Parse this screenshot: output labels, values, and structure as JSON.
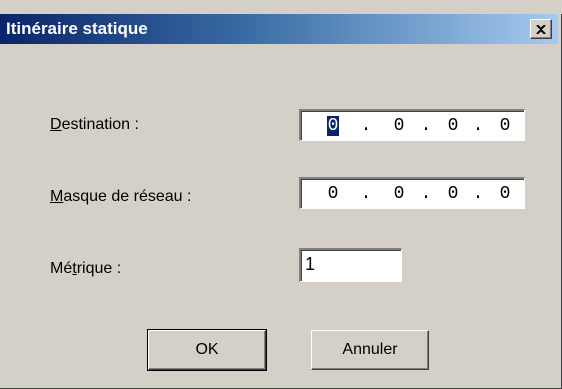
{
  "window": {
    "title": "Itinéraire statique",
    "close_icon": "close-icon"
  },
  "form": {
    "destination": {
      "label": "Destination :",
      "accesskey": "D",
      "octets": [
        "0",
        "0",
        "0",
        "0"
      ],
      "selected_octet": 0
    },
    "mask": {
      "label": "Masque de réseau :",
      "accesskey": "M",
      "octets": [
        "0",
        "0",
        "0",
        "0"
      ]
    },
    "metric": {
      "label": "Métrique :",
      "accesskey": "t",
      "value": "1"
    }
  },
  "buttons": {
    "ok": "OK",
    "cancel": "Annuler"
  },
  "colors": {
    "title_start": "#0a246a",
    "title_end": "#a6caf0",
    "face": "#d4d0c8",
    "selection": "#0a246a"
  }
}
